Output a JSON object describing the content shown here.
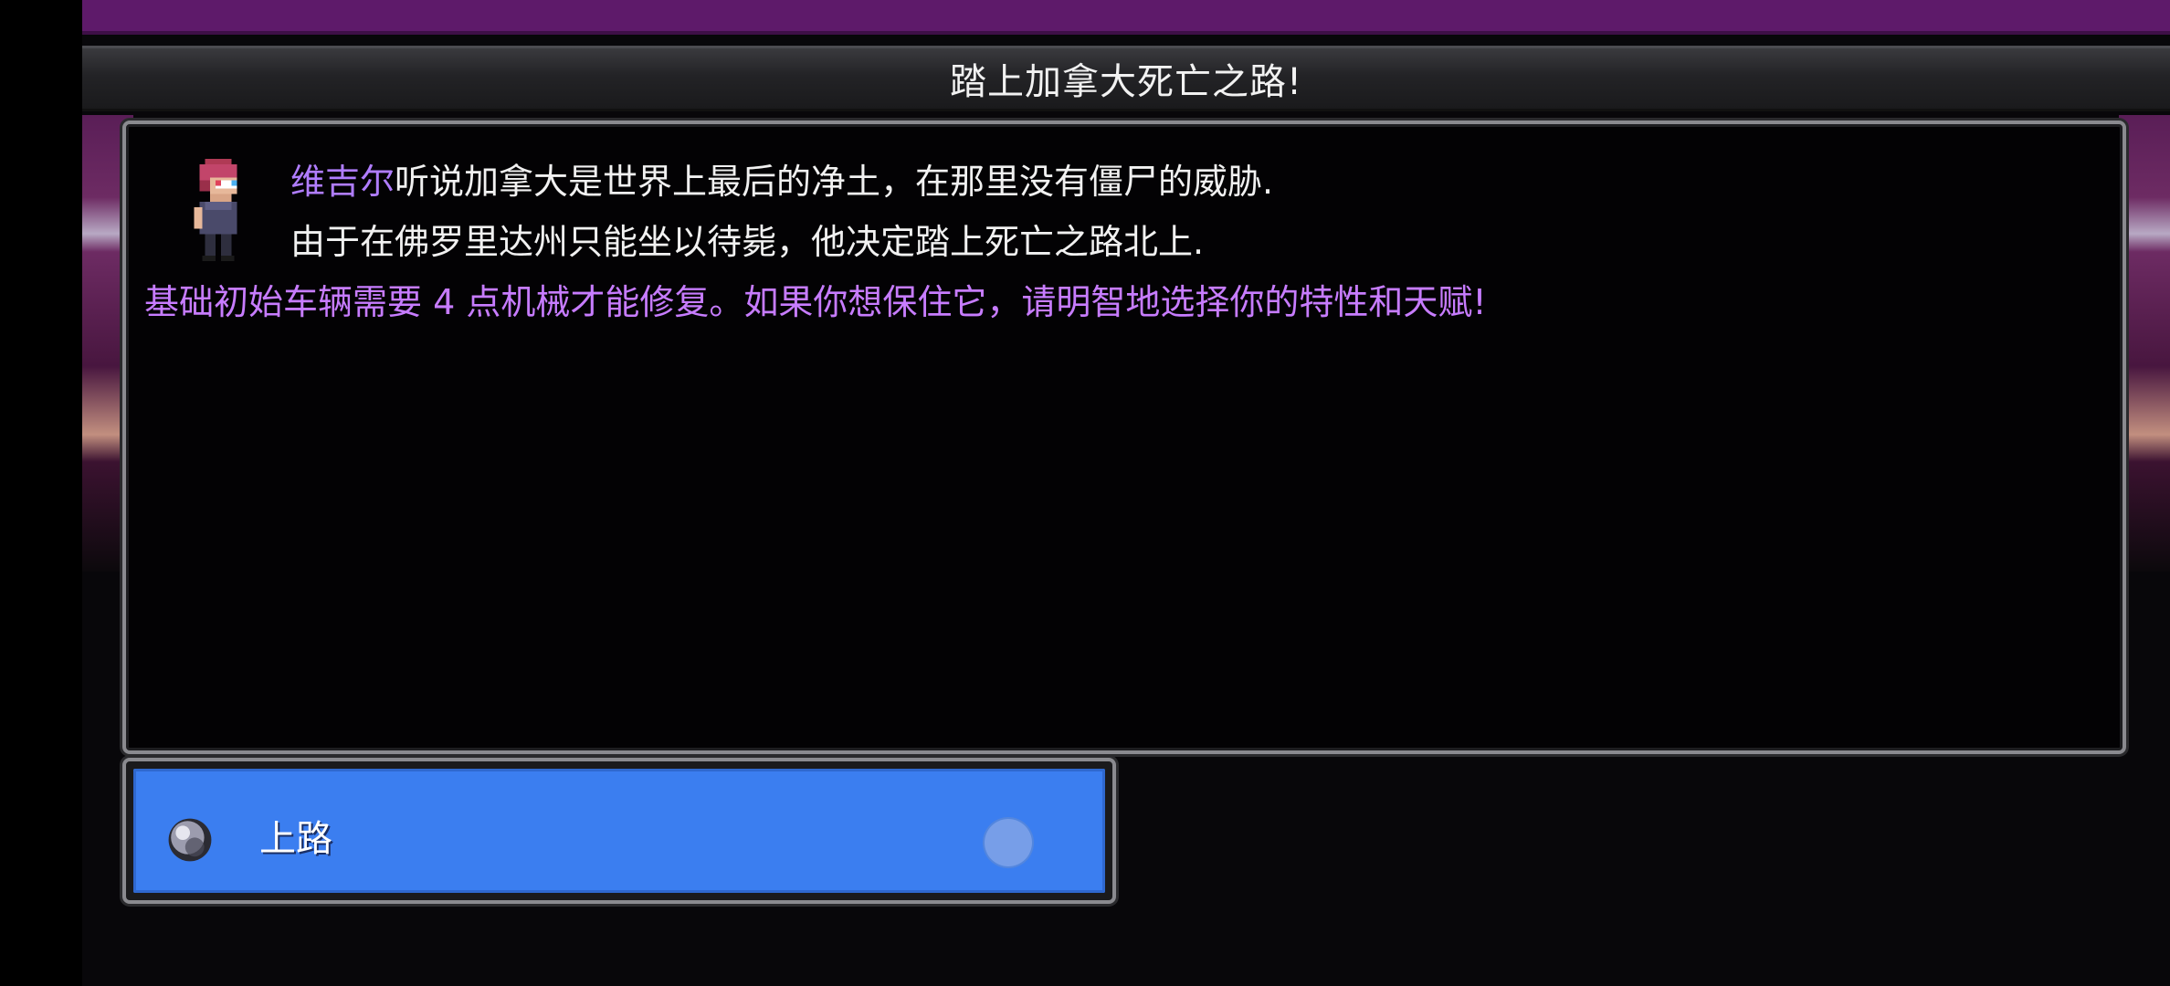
{
  "header": {
    "title": "踏上加拿大死亡之路!"
  },
  "story": {
    "speaker": "维吉尔",
    "line1_rest": "听说加拿大是世界上最后的净土，在那里没有僵尸的威胁.",
    "line2": "由于在佛罗里达州只能坐以待毙，他决定踏上死亡之路北上.",
    "line3": "基础初始车辆需要  4 点机械才能修复。如果你想保住它，请明智地选择你的特性和天赋!"
  },
  "choices": [
    {
      "label": "上路",
      "icon": "gem-orb-icon"
    }
  ],
  "colors": {
    "speaker": "#b07dff",
    "hint_text": "#c77cff",
    "choice_bg": "#3b7ef0",
    "top_band": "#5e1a6a"
  }
}
